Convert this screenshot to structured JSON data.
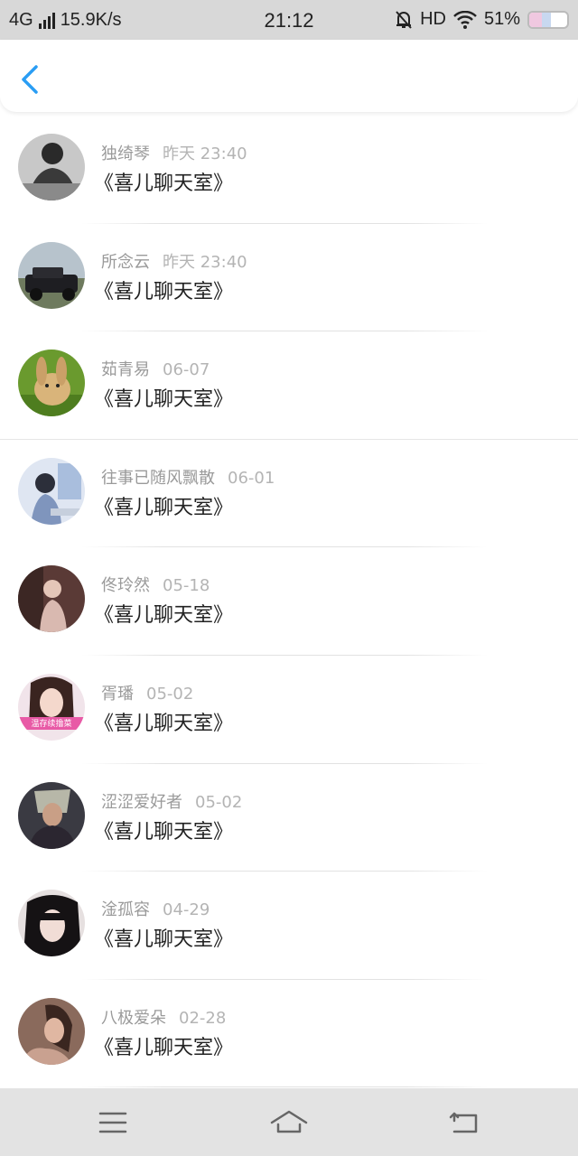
{
  "status_bar": {
    "network": "4G",
    "speed": "15.9K/s",
    "time": "21:12",
    "hd": "HD",
    "battery": "51%",
    "icons": [
      "signal-icon",
      "mute-bell-icon",
      "wifi-icon",
      "battery-icon"
    ]
  },
  "header": {
    "back_icon": "chevron-left-icon",
    "accent": "#2a9df4"
  },
  "items": [
    {
      "name": "独绮琴",
      "time": "昨天 23:40",
      "message": "《喜儿聊天室》",
      "avatar_color": "#8a8a8a"
    },
    {
      "name": "所念云",
      "time": "昨天 23:40",
      "message": "《喜儿聊天室》",
      "avatar_color": "#5b6b78"
    },
    {
      "name": "茹青易",
      "time": "06-07",
      "message": "《喜儿聊天室》",
      "avatar_color": "#7fae3c"
    },
    {
      "name": "往事已随风飘散",
      "time": "06-01",
      "message": "《喜儿聊天室》",
      "avatar_color": "#8fa9cf"
    },
    {
      "name": "佟玲然",
      "time": "05-18",
      "message": "《喜儿聊天室》",
      "avatar_color": "#6d4a46"
    },
    {
      "name": "胥璠",
      "time": "05-02",
      "message": "《喜儿聊天室》",
      "avatar_color": "#c9a9b8"
    },
    {
      "name": "涩涩爱好者",
      "time": "05-02",
      "message": "《喜儿聊天室》",
      "avatar_color": "#4e4a52"
    },
    {
      "name": "淦孤容",
      "time": "04-29",
      "message": "《喜儿聊天室》",
      "avatar_color": "#3a3436"
    },
    {
      "name": "八极爱朵",
      "time": "02-28",
      "message": "《喜儿聊天室》",
      "avatar_color": "#9a7766"
    }
  ],
  "avatar_watermark": "温存续撸菜",
  "nav": {
    "icons": [
      "menu-icon",
      "home-icon",
      "back-icon"
    ]
  }
}
